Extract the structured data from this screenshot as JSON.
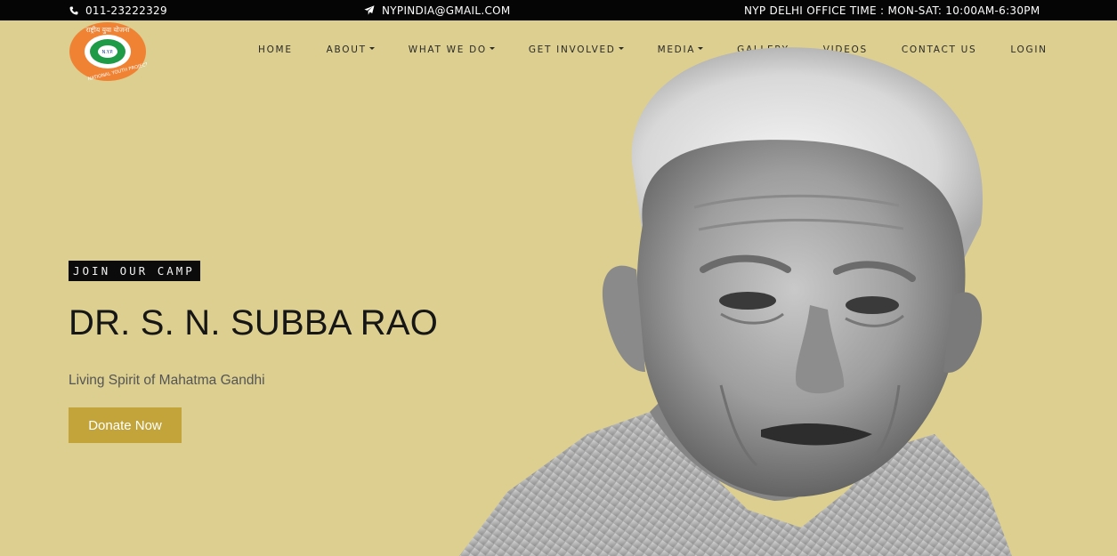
{
  "topbar": {
    "phone": "011-23222329",
    "email": "NYPINDIA@GMAIL.COM",
    "office_time": "NYP DELHI OFFICE TIME : MON-SAT: 10:00AM-6:30PM",
    "phone_icon": "phone-icon",
    "email_icon": "paper-plane-icon"
  },
  "logo": {
    "hindi_text": "राष्ट्रीय युवा योजना",
    "center_text": "N.Y.P.",
    "ring_text": "NATIONAL YOUTH PROJECT"
  },
  "nav": {
    "items": [
      {
        "label": "HOME",
        "dropdown": false
      },
      {
        "label": "ABOUT",
        "dropdown": true
      },
      {
        "label": "WHAT WE DO",
        "dropdown": true
      },
      {
        "label": "GET INVOLVED",
        "dropdown": true
      },
      {
        "label": "MEDIA",
        "dropdown": true
      },
      {
        "label": "GALLERY",
        "dropdown": false
      },
      {
        "label": "VIDEOS",
        "dropdown": false
      },
      {
        "label": "CONTACT US",
        "dropdown": false
      },
      {
        "label": "LOGIN",
        "dropdown": false
      }
    ]
  },
  "hero": {
    "tag": "JOIN OUR CAMP",
    "title": "DR. S. N. SUBBA RAO",
    "subtitle": "Living Spirit of Mahatma Gandhi",
    "cta": "Donate Now"
  },
  "colors": {
    "background": "#dccf8f",
    "topbar": "#050505",
    "accent": "#c2a43a",
    "logo_orange": "#f08234",
    "logo_green": "#1f9a47"
  }
}
